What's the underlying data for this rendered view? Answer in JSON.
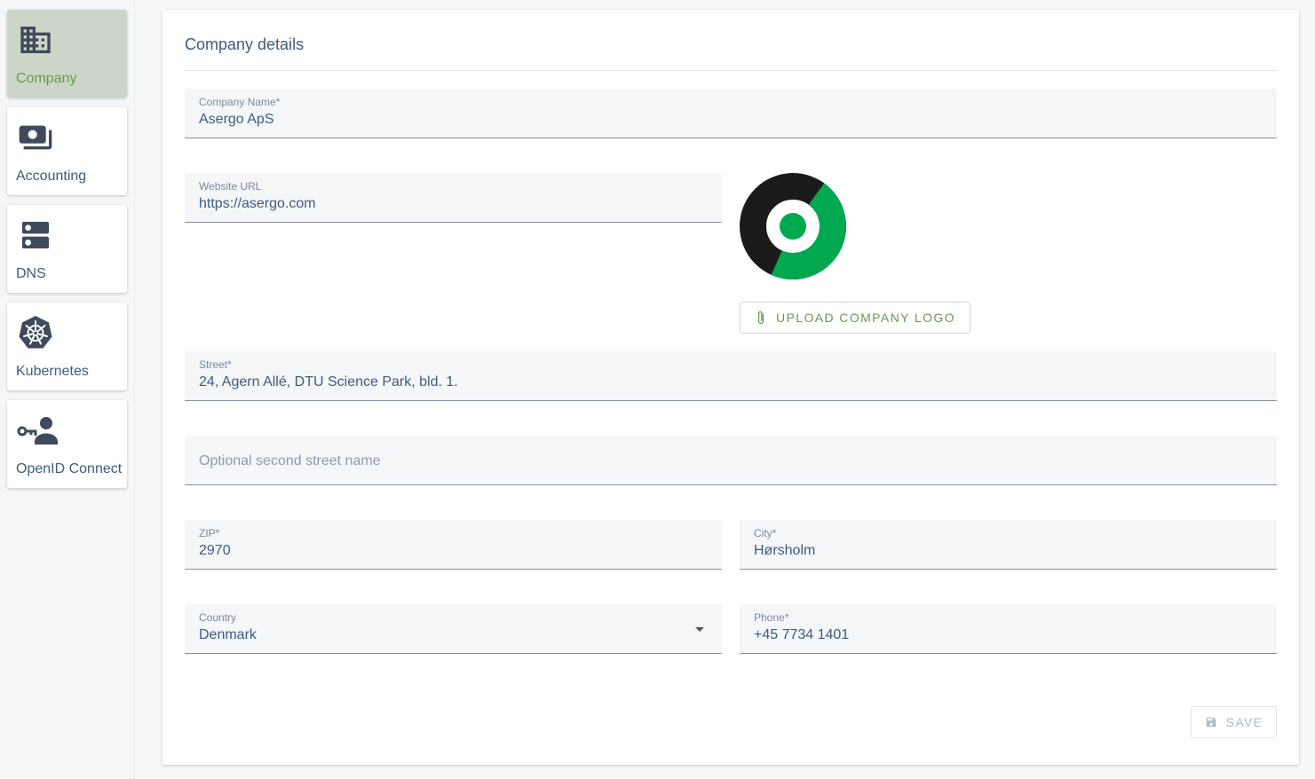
{
  "sidebar": {
    "items": [
      {
        "label": "Company",
        "icon": "building-icon",
        "active": true
      },
      {
        "label": "Accounting",
        "icon": "money-icon",
        "active": false
      },
      {
        "label": "DNS",
        "icon": "dns-icon",
        "active": false
      },
      {
        "label": "Kubernetes",
        "icon": "kubernetes-icon",
        "active": false
      },
      {
        "label": "OpenID Connect",
        "icon": "key-person-icon",
        "active": false
      }
    ]
  },
  "main": {
    "title": "Company details",
    "fields": {
      "company_name": {
        "label": "Company Name*",
        "value": "Asergo ApS"
      },
      "website": {
        "label": "Website URL",
        "value": "https://asergo.com"
      },
      "street": {
        "label": "Street*",
        "value": "24, Agern Allé, DTU Science Park, bld. 1."
      },
      "street2": {
        "placeholder": "Optional second street name",
        "value": ""
      },
      "zip": {
        "label": "ZIP*",
        "value": "2970"
      },
      "city": {
        "label": "City*",
        "value": "Hørsholm"
      },
      "country": {
        "label": "Country",
        "value": "Denmark"
      },
      "phone": {
        "label": "Phone*",
        "value": "+45 7734 1401"
      }
    },
    "upload_logo_label": "UPLOAD COMPANY LOGO",
    "save_label": "SAVE"
  },
  "colors": {
    "accent_green": "#6a9a53",
    "text_blue": "#3e5b84",
    "logo_green": "#00a84f",
    "logo_black": "#1a1a1a"
  }
}
